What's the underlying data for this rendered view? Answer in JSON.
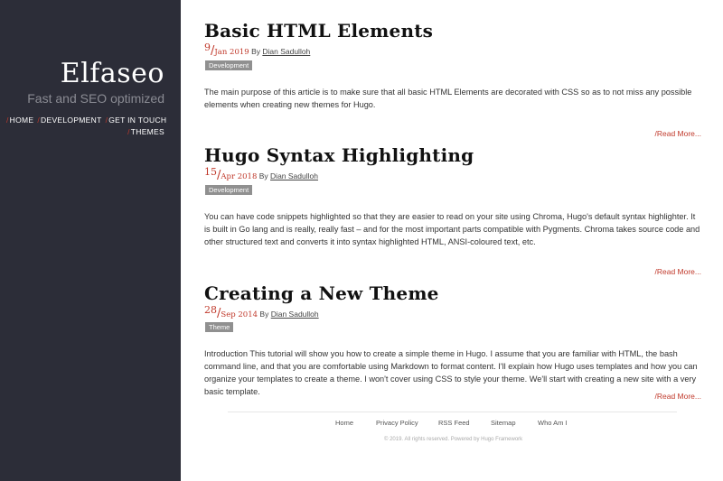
{
  "sidebar": {
    "title": "Elfaseo",
    "tagline": "Fast and SEO optimized",
    "menu": [
      {
        "label": "Home"
      },
      {
        "label": "Development"
      },
      {
        "label": "Get in touch"
      },
      {
        "label": "Themes"
      }
    ]
  },
  "posts": [
    {
      "title": "Basic HTML Elements",
      "day": "9",
      "month_year": "Jan 2019",
      "by": "By",
      "author": "Dian Sadulloh",
      "tag": "Development",
      "excerpt": "The main purpose of this article is to make sure that all basic HTML Elements are decorated with CSS so as to not miss any possible elements when creating new themes for Hugo.",
      "read_more": "Read More..."
    },
    {
      "title": "Hugo Syntax Highlighting",
      "day": "15",
      "month_year": "Apr 2018",
      "by": "By",
      "author": "Dian Sadulloh",
      "tag": "Development",
      "excerpt": "You can have code snippets highlighted so that they are easier to read on your site using Chroma, Hugo's default syntax highlighter. It is built in Go lang and is really, really fast – and for the most important parts compatible with Pygments. Chroma takes source code and other structured text and converts it into syntax highlighted HTML, ANSI-coloured text, etc.",
      "read_more": "Read More..."
    },
    {
      "title": "Creating a New Theme",
      "day": "28",
      "month_year": "Sep 2014",
      "by": "By",
      "author": "Dian Sadulloh",
      "tag": "Theme",
      "excerpt": "Introduction This tutorial will show you how to create a simple theme in Hugo. I assume that you are familiar with HTML, the bash command line, and that you are comfortable using Markdown to format content. I'll explain how Hugo uses templates and how you can organize your templates to create a theme. I won't cover using CSS to style your theme. We'll start with creating a new site with a very basic template.",
      "read_more": "Read More..."
    }
  ],
  "footer": {
    "links": [
      "Home",
      "Privacy Policy",
      "RSS Feed",
      "Sitemap",
      "Who Am I"
    ],
    "copyright": "© 2019. All rights reserved. Powered by Hugo Framework"
  },
  "colors": {
    "sidebar_bg": "#2c2d38",
    "accent": "#c0392b",
    "tag_bg": "#909090"
  }
}
